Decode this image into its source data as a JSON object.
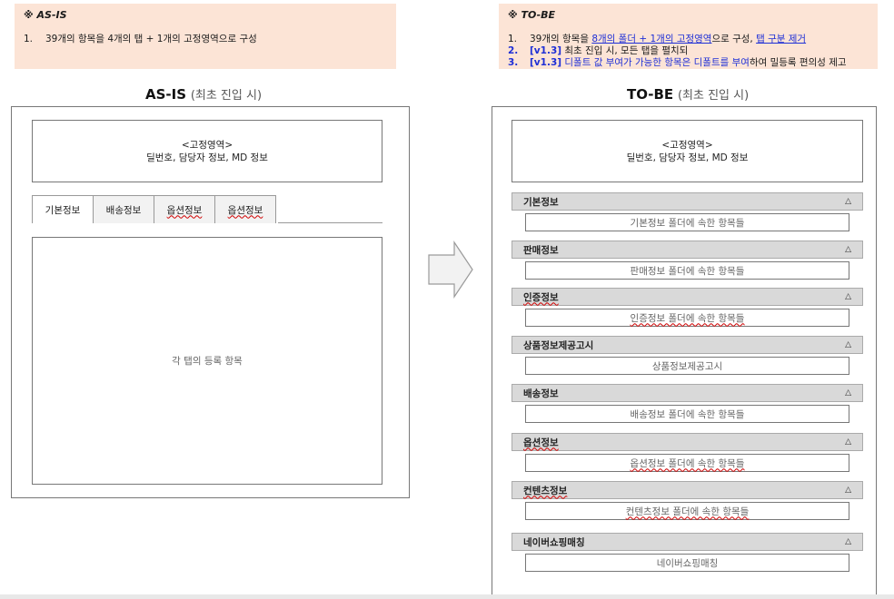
{
  "asis_note": {
    "title": "※ AS-IS",
    "items": [
      {
        "num": "1.",
        "text": "39개의 항목을 4개의 탭 + 1개의 고정영역으로 구성"
      }
    ]
  },
  "tobe_note": {
    "title": "※ TO-BE",
    "item1": {
      "num": "1.",
      "a": "39개의 항목을 ",
      "b": "8개의 폴더 + 1개의 고정영역",
      "c": "으로 구성, ",
      "d": "탭 구분 제거"
    },
    "item2": {
      "num": "2.",
      "tag": "[v1.3]",
      "text": " 최초 진입 시, 모든 탭을 펼치되"
    },
    "item3": {
      "num": "3.",
      "tag": "[v1.3]",
      "a": " 디폴트 값 부여가 가능한 항목은 디폴트를 부여",
      "b": "하여 밀등록 편의성 제고"
    }
  },
  "asis": {
    "heading": "AS-IS",
    "heading_sub": "(최초 진입 시)",
    "fixed_area_title": "<고정영역>",
    "fixed_area_desc": "딜번호, 담당자 정보, MD 정보",
    "tabs": [
      "기본정보",
      "배송정보",
      "옵션정보",
      "옵션정보"
    ],
    "content_text": "각 탭의 등록 항목"
  },
  "tobe": {
    "heading": "TO-BE",
    "heading_sub": "(최초 진입 시)",
    "fixed_area_title": "<고정영역>",
    "fixed_area_desc": "딜번호, 담당자 정보, MD 정보",
    "collapse_glyph": "△",
    "folders": [
      {
        "title": "기본정보",
        "item": "기본정보 폴더에 속한 항목들"
      },
      {
        "title": "판매정보",
        "item": "판매정보 폴더에 속한 항목들"
      },
      {
        "title": "인증정보",
        "item": "인증정보 폴더에 속한 항목들"
      },
      {
        "title": "상품정보제공고시",
        "item": "상품정보제공고시"
      },
      {
        "title": "배송정보",
        "item": "배송정보 폴더에 속한 항목들"
      },
      {
        "title": "옵션정보",
        "item": "옵션정보 폴더에 속한 항목들"
      },
      {
        "title": "컨텐츠정보",
        "item": "컨텐츠정보 폴더에 속한 항목들"
      },
      {
        "title": "네이버쇼핑매칭",
        "item": "네이버쇼핑매칭"
      }
    ]
  }
}
